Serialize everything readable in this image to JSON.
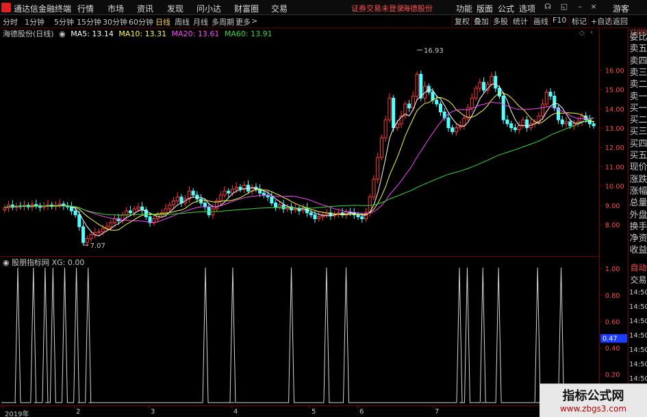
{
  "titlebar": {
    "app_name": "通达信金融终端",
    "menus": [
      "行情",
      "市场",
      "资讯",
      "发现",
      "问小达",
      "财富圈",
      "交易"
    ],
    "warning": "证券交易未登录",
    "stock_name": "海德股份",
    "right_menus": [
      "功能",
      "版面",
      "公式",
      "选项"
    ],
    "user": "游客"
  },
  "tabbar": {
    "periods": [
      "分时",
      "1分钟",
      "5分钟",
      "15分钟",
      "30分钟",
      "60分钟",
      "日线",
      "周线",
      "月线",
      "多周期",
      "更多"
    ],
    "active": "日线",
    "more_arrow": ">",
    "right_buttons": [
      "复权",
      "叠加",
      "多股",
      "统计",
      "画线",
      "F10",
      "标记",
      "+自选",
      "返回"
    ]
  },
  "main_legend": {
    "title": "海德股份(日线)",
    "ma5": "MA5: 13.14",
    "ma10": "MA10: 13.31",
    "ma20": "MA20: 13.61",
    "ma60": "MA60: 13.91"
  },
  "colors": {
    "up": "#ff3b3b",
    "down": "#54ffff",
    "ma5": "#ffffff",
    "ma10": "#ffff3c",
    "ma20": "#ff44ff",
    "ma60": "#33dd33",
    "axis_red": "#ff4d4d",
    "current_tag": "#1c3cff"
  },
  "chart_data": [
    {
      "type": "candlestick",
      "title": "海德股份(日线)",
      "yaxis_ticks": [
        "16.00",
        "15.00",
        "14.00",
        "13.00",
        "12.00",
        "11.00",
        "10.00",
        "9.00",
        "8.00"
      ],
      "ylim": [
        7.0,
        17.0
      ],
      "high_label": "16.93",
      "low_label": "7.07",
      "ma": {
        "MA5": 13.14,
        "MA10": 13.31,
        "MA20": 13.61,
        "MA60": 13.91
      },
      "x_labels": [
        "2019年",
        "2",
        "3",
        "4",
        "5",
        "6",
        "7"
      ],
      "closes": [
        8.95,
        9.1,
        8.98,
        9.05,
        9.02,
        9.08,
        9.0,
        9.12,
        9.06,
        8.98,
        9.04,
        9.1,
        9.02,
        9.08,
        9.15,
        9.05,
        9.0,
        8.8,
        8.6,
        8.0,
        7.2,
        7.4,
        7.6,
        7.7,
        7.75,
        7.9,
        8.0,
        8.2,
        8.4,
        8.3,
        8.6,
        8.8,
        8.7,
        8.9,
        9.0,
        8.85,
        8.5,
        8.2,
        8.4,
        8.6,
        8.7,
        8.9,
        9.1,
        9.3,
        9.5,
        9.2,
        9.4,
        9.8,
        9.6,
        9.4,
        9.2,
        9.0,
        8.6,
        8.9,
        9.3,
        9.6,
        9.8,
        9.7,
        9.9,
        10.0,
        9.9,
        10.1,
        9.8,
        10.0,
        9.9,
        9.7,
        9.6,
        9.5,
        9.2,
        9.0,
        9.1,
        8.9,
        9.0,
        8.85,
        8.9,
        8.8,
        8.95,
        8.7,
        8.6,
        8.4,
        8.5,
        8.6,
        8.7,
        8.55,
        8.65,
        8.7,
        8.6,
        8.75,
        8.7,
        8.6,
        8.5,
        8.4,
        8.7,
        9.5,
        10.4,
        11.5,
        12.5,
        13.4,
        14.5,
        13.0,
        13.2,
        13.6,
        14.2,
        14.0,
        14.6,
        15.7,
        14.5,
        15.1,
        14.8,
        14.4,
        14.2,
        13.8,
        13.5,
        13.0,
        12.8,
        13.0,
        13.1,
        13.5,
        14.0,
        14.5,
        15.0,
        15.3,
        14.9,
        15.2,
        15.6,
        15.0,
        14.6,
        13.4,
        13.2,
        13.0,
        12.9,
        13.1,
        13.4,
        13.0,
        13.2,
        13.3,
        13.6,
        14.2,
        14.8,
        14.6,
        14.0,
        13.4,
        13.2,
        13.3,
        13.1,
        13.2,
        13.3,
        13.6,
        13.4,
        13.2,
        13.1
      ],
      "opens": [
        8.85,
        8.95,
        9.1,
        8.98,
        9.05,
        9.02,
        9.08,
        9.0,
        9.12,
        9.06,
        8.98,
        9.04,
        9.1,
        9.02,
        9.08,
        9.15,
        9.05,
        9.0,
        8.8,
        8.6,
        8.0,
        7.2,
        7.4,
        7.6,
        7.7,
        7.75,
        7.9,
        8.0,
        8.2,
        8.4,
        8.3,
        8.6,
        8.8,
        8.7,
        8.9,
        9.0,
        8.85,
        8.5,
        8.2,
        8.4,
        8.6,
        8.7,
        8.9,
        9.1,
        9.3,
        9.5,
        9.2,
        9.4,
        9.8,
        9.6,
        9.4,
        9.2,
        9.0,
        8.6,
        8.9,
        9.3,
        9.6,
        9.8,
        9.7,
        9.9,
        10.0,
        9.9,
        10.1,
        9.8,
        10.0,
        9.9,
        9.7,
        9.6,
        9.5,
        9.2,
        9.0,
        9.1,
        8.9,
        9.0,
        8.85,
        8.9,
        8.8,
        8.95,
        8.7,
        8.6,
        8.4,
        8.5,
        8.6,
        8.7,
        8.55,
        8.65,
        8.7,
        8.6,
        8.75,
        8.7,
        8.6,
        8.5,
        8.4,
        8.7,
        9.5,
        10.4,
        11.5,
        12.5,
        13.4,
        14.5,
        13.0,
        13.2,
        13.6,
        14.2,
        14.0,
        14.6,
        15.7,
        14.5,
        15.1,
        14.8,
        14.4,
        14.2,
        13.8,
        13.5,
        13.0,
        12.8,
        13.0,
        13.1,
        13.5,
        14.0,
        14.5,
        15.0,
        15.3,
        14.9,
        15.2,
        15.6,
        15.0,
        14.6,
        13.4,
        13.2,
        13.0,
        12.9,
        13.1,
        13.4,
        13.0,
        13.2,
        13.3,
        13.6,
        14.2,
        14.8,
        14.6,
        14.0,
        13.4,
        13.2,
        13.3,
        13.1,
        13.2,
        13.3,
        13.6,
        13.4,
        13.2
      ]
    },
    {
      "type": "line",
      "title": "股朋指标网 XG: 0.00",
      "yaxis_ticks": [
        "1.00",
        "0.80",
        "0.60",
        "0.40",
        "0.20"
      ],
      "ylim": [
        0,
        1
      ],
      "current_value": "0.47",
      "spikes_at": [
        3,
        7,
        10,
        12,
        15,
        18,
        21,
        51,
        58,
        73,
        82,
        87,
        116,
        118,
        122,
        126,
        136,
        142,
        174,
        199
      ]
    }
  ],
  "side_panel": {
    "items": [
      "委比",
      "卖五",
      "卖四",
      "卖三",
      "卖二",
      "卖一",
      "买一",
      "买二",
      "买三",
      "买四",
      "买五",
      "现价",
      "涨跌",
      "涨幅",
      "总量",
      "外盘",
      "换手",
      "净资",
      "收益"
    ],
    "tag": "Y1000"
  },
  "sub_side": {
    "items": [
      "自动",
      "交易"
    ],
    "times": [
      "14:50",
      "14:50",
      "14:50",
      "14:50",
      "14:50",
      "14:50",
      "14:50",
      "14:50"
    ]
  },
  "watermark": {
    "title": "指标公式网",
    "url": "www.zbgs3.com"
  }
}
